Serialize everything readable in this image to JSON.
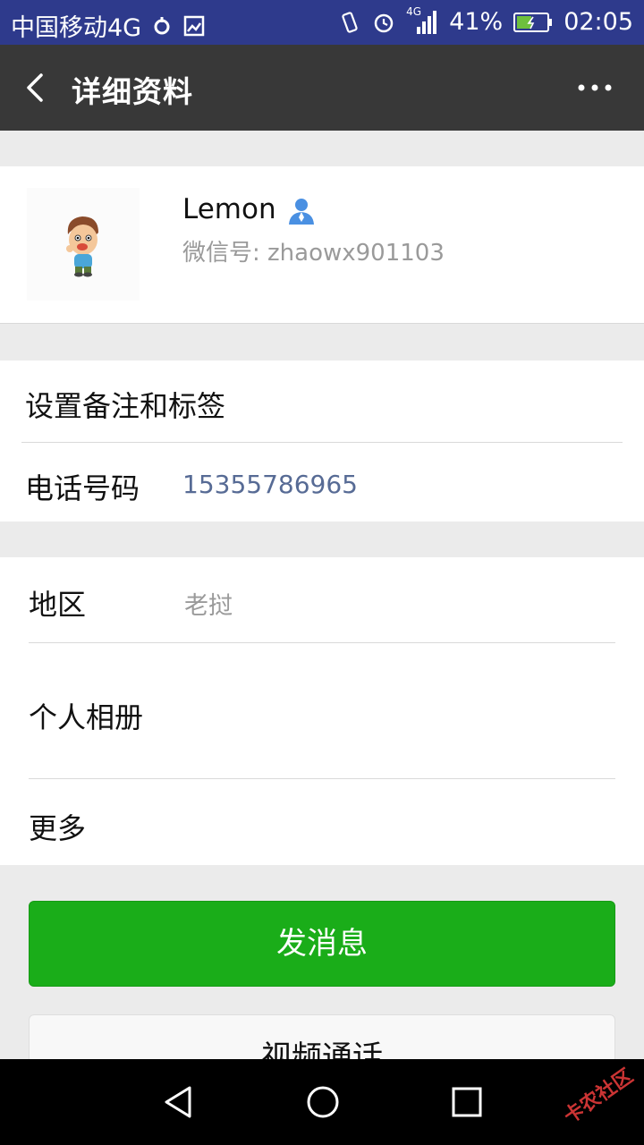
{
  "status_bar": {
    "carrier": "中国移动4G",
    "battery": "41%",
    "time": "02:05",
    "network_badge": "4G"
  },
  "header": {
    "title": "详细资料",
    "back_icon": "chevron-left-icon",
    "more_icon": "more-dots-icon"
  },
  "profile": {
    "name": "Lemon",
    "wechat_id": "微信号: zhaowx901103",
    "contact_icon": "contact-person-icon",
    "accent_color": "#4a90e2"
  },
  "group1": {
    "remark_label": "设置备注和标签",
    "phone_label": "电话号码",
    "phone_value": "15355786965",
    "phone_color": "#576b95"
  },
  "group2": {
    "region_label": "地区",
    "region_value": "老挝",
    "album_label": "个人相册",
    "more_label": "更多"
  },
  "actions": {
    "send_message": "发消息",
    "video_call": "视频通话",
    "primary_color": "#1aad19"
  },
  "nav_bar": {
    "back_icon": "triangle-back-icon",
    "home_icon": "circle-home-icon",
    "recent_icon": "square-recent-icon"
  },
  "watermark": "卡农社区"
}
